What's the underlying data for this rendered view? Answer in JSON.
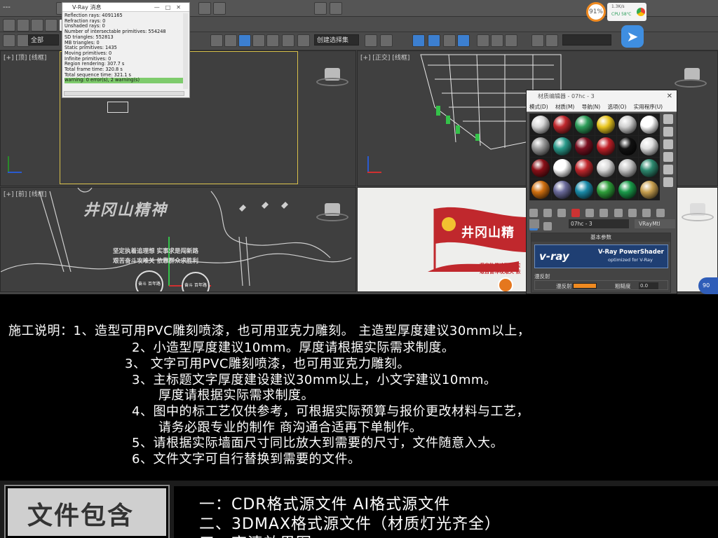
{
  "app": {
    "title_bar_text": "---",
    "toolbar": {
      "select_all_label": "全部",
      "named_selection_label": "创建选择集"
    },
    "viewports": {
      "top": "[+] [顶] [线框]",
      "front": "[+] [正交] [线框]",
      "left": "[+] [前] [线框]",
      "perspective": ""
    },
    "status": {
      "cpu_percent": "91%",
      "net_speed": "1.3K/s",
      "cpu_temp": "CPU 58℃",
      "corner_percent": "90"
    }
  },
  "vray_message": {
    "title": "V-Ray 消息",
    "lines": [
      "Reflection rays: 4091165",
      "Refraction rays: 0",
      "Unshaded rays: 0",
      "Number of intersectable primitives: 554248",
      "SD triangles: 552813",
      "MB triangles: 0",
      "Static primitives: 1435",
      "Moving primitives: 0",
      "Infinite primitives: 0",
      "Region rendering: 307.7 s",
      "Total frame time: 320.8 s",
      "Total sequence time: 321.1 s"
    ],
    "warning": "warning: 0 error(s), 2 warning(s)"
  },
  "material_editor": {
    "title": "材质编辑器 - 07hc - 3",
    "menu": [
      "模式(D)",
      "材质(M)",
      "导航(N)",
      "选项(O)",
      "实用程序(U)"
    ],
    "spheres": [
      "#d8d8d8",
      "#c0282d",
      "#2e9e5a",
      "#e9c620",
      "#d0d0d0",
      "#ffffff",
      "#9a9a9a",
      "#2a9a8a",
      "#7a1020",
      "#c02028",
      "#111111",
      "#e0e0e0",
      "#8a1018",
      "#ffffff",
      "#c0282d",
      "#d8d8d8",
      "#c4c4c4",
      "#2e8a70",
      "#d07010",
      "#6a6a9a",
      "#1a8aa8",
      "#2e9e3a",
      "#1a9a4a",
      "#c8a050"
    ],
    "material_name": "07hc - 3",
    "material_type": "VRayMtl",
    "params_title": "基本参数",
    "vray_logo": "v-ray",
    "vray_product": "V-Ray PowerShader",
    "vray_tagline": "optimized for V-Ray",
    "diffuse_section": "漫反射",
    "diffuse_label": "漫反射",
    "roughness_label": "粗糙度",
    "roughness_value": "0.0",
    "diffuse_color": "#f08a20"
  },
  "artwork": {
    "slogan": "井冈山精神",
    "slogan_persp": "井冈山精",
    "left_line1": "坚定执着追理想  实事求是闯新路",
    "left_line2": "艰苦奋斗攻难关  依靠群众求胜利",
    "persp_line1": "坚定执着追理想  实",
    "persp_line2": "艰苦奋斗攻难关  依",
    "badge1": "奋斗 百年路",
    "badge2": "奋斗 百年路",
    "flag_color": "#c0282d"
  },
  "instructions": {
    "line1": "施工说明：1、造型可用PVC雕刻喷漆，也可用亚克力雕刻。 主造型厚度建议30mm以上，",
    "line2": "2、小造型厚度建议10mm。厚度请根据实际需求制度。",
    "line3": "3、 文字可用PVC雕刻喷漆，也可用亚克力雕刻。",
    "line4": "3、主标题文字厚度建设建议30mm以上，小文字建议10mm。",
    "line5": "厚度请根据实际需求制度。",
    "line6": "4、图中的标工艺仅供参考，可根据实际预算与报价更改材料与工艺，",
    "line7": "请务必跟专业的制作 商沟通合适再下单制作。",
    "line8": "5、请根据实际墙面尺寸同比放大到需要的尺寸，文件随意入大。",
    "line9": "6、文件文字可自行替换到需要的文件。"
  },
  "files": {
    "label": "文件包含",
    "items": [
      "一：CDR格式源文件  AI格式源文件",
      "二、3DMAX格式源文件（材质灯光齐全）",
      "三、高清效果图"
    ]
  }
}
